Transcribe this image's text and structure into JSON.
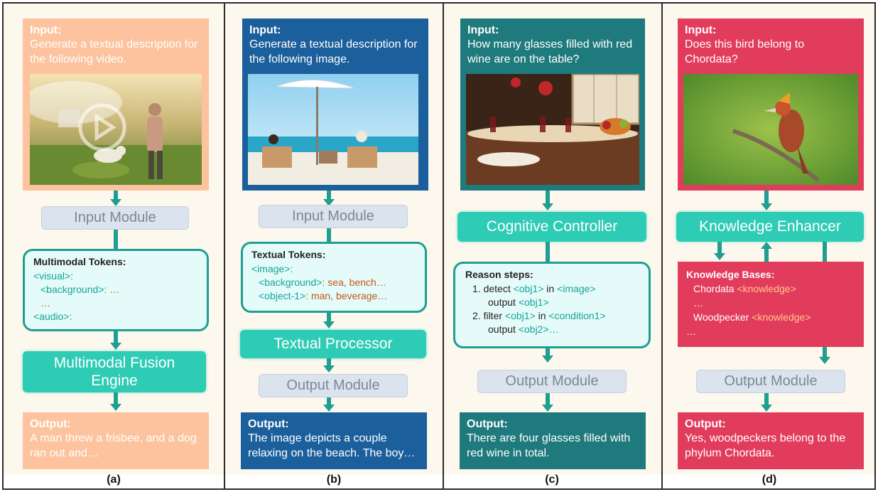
{
  "panels": [
    {
      "caption": "(a)",
      "input_label": "Input:",
      "input_text": "Generate a textual description for the following video.",
      "module1": "Input Module",
      "tokens_title": "Multimodal Tokens:",
      "tokens": {
        "l1": "<visual>:",
        "l2": "<background>:",
        "l2v": " …",
        "l3": "…",
        "l4": "<audio>:"
      },
      "module2": "Multimodal Fusion Engine",
      "output_label": "Output:",
      "output_text": "A man threw a frisbee, and a dog ran out and…"
    },
    {
      "caption": "(b)",
      "input_label": "Input:",
      "input_text": "Generate a textual description for the following image.",
      "module1": "Input Module",
      "tokens_title": "Textual Tokens:",
      "tokens": {
        "l1": "<image>:",
        "l2": "<background>",
        "l2v": ": sea, bench…",
        "l3": "<object-1>",
        "l3v": ": man, beverage…"
      },
      "module2": "Textual Processor",
      "module3": "Output Module",
      "output_label": "Output:",
      "output_text": "The image depicts a couple relaxing on the beach. The boy…"
    },
    {
      "caption": "(c)",
      "input_label": "Input:",
      "input_text": "How many glasses filled with red wine are on the table?",
      "module1": "Cognitive Controller",
      "tokens_title": "Reason steps:",
      "steps": {
        "s1a": "1. detect ",
        "s1b": "<obj1>",
        "s1c": " in ",
        "s1d": "<image>",
        "s2a": "output ",
        "s2b": "<obj1>",
        "s3a": "2. filter ",
        "s3b": "<obj1>",
        "s3c": " in ",
        "s3d": "<condition1>",
        "s4a": "output ",
        "s4b": "<obj2>…"
      },
      "module3": "Output Module",
      "output_label": "Output:",
      "output_text": "There are four glasses filled with red wine in total."
    },
    {
      "caption": "(d)",
      "input_label": "Input:",
      "input_text": "Does this bird belong to Chordata?",
      "module1": "Knowledge Enhancer",
      "kb_title": "Knowledge Bases:",
      "kb": {
        "k1": "Chordata ",
        "k1v": "<knowledge>",
        "k2": "…",
        "k3": "Woodpecker ",
        "k3v": "<knowledge>",
        "k4": "…"
      },
      "module3": "Output Module",
      "output_label": "Output:",
      "output_text": "Yes, woodpeckers belong to the phylum Chordata."
    }
  ],
  "colors": {
    "panel_a": "#fcc39e",
    "panel_b": "#1b5f9c",
    "panel_c": "#1f7a7d",
    "panel_d": "#e23c5c",
    "teal": "#2ecbb5",
    "arrow": "#1f9e92"
  }
}
